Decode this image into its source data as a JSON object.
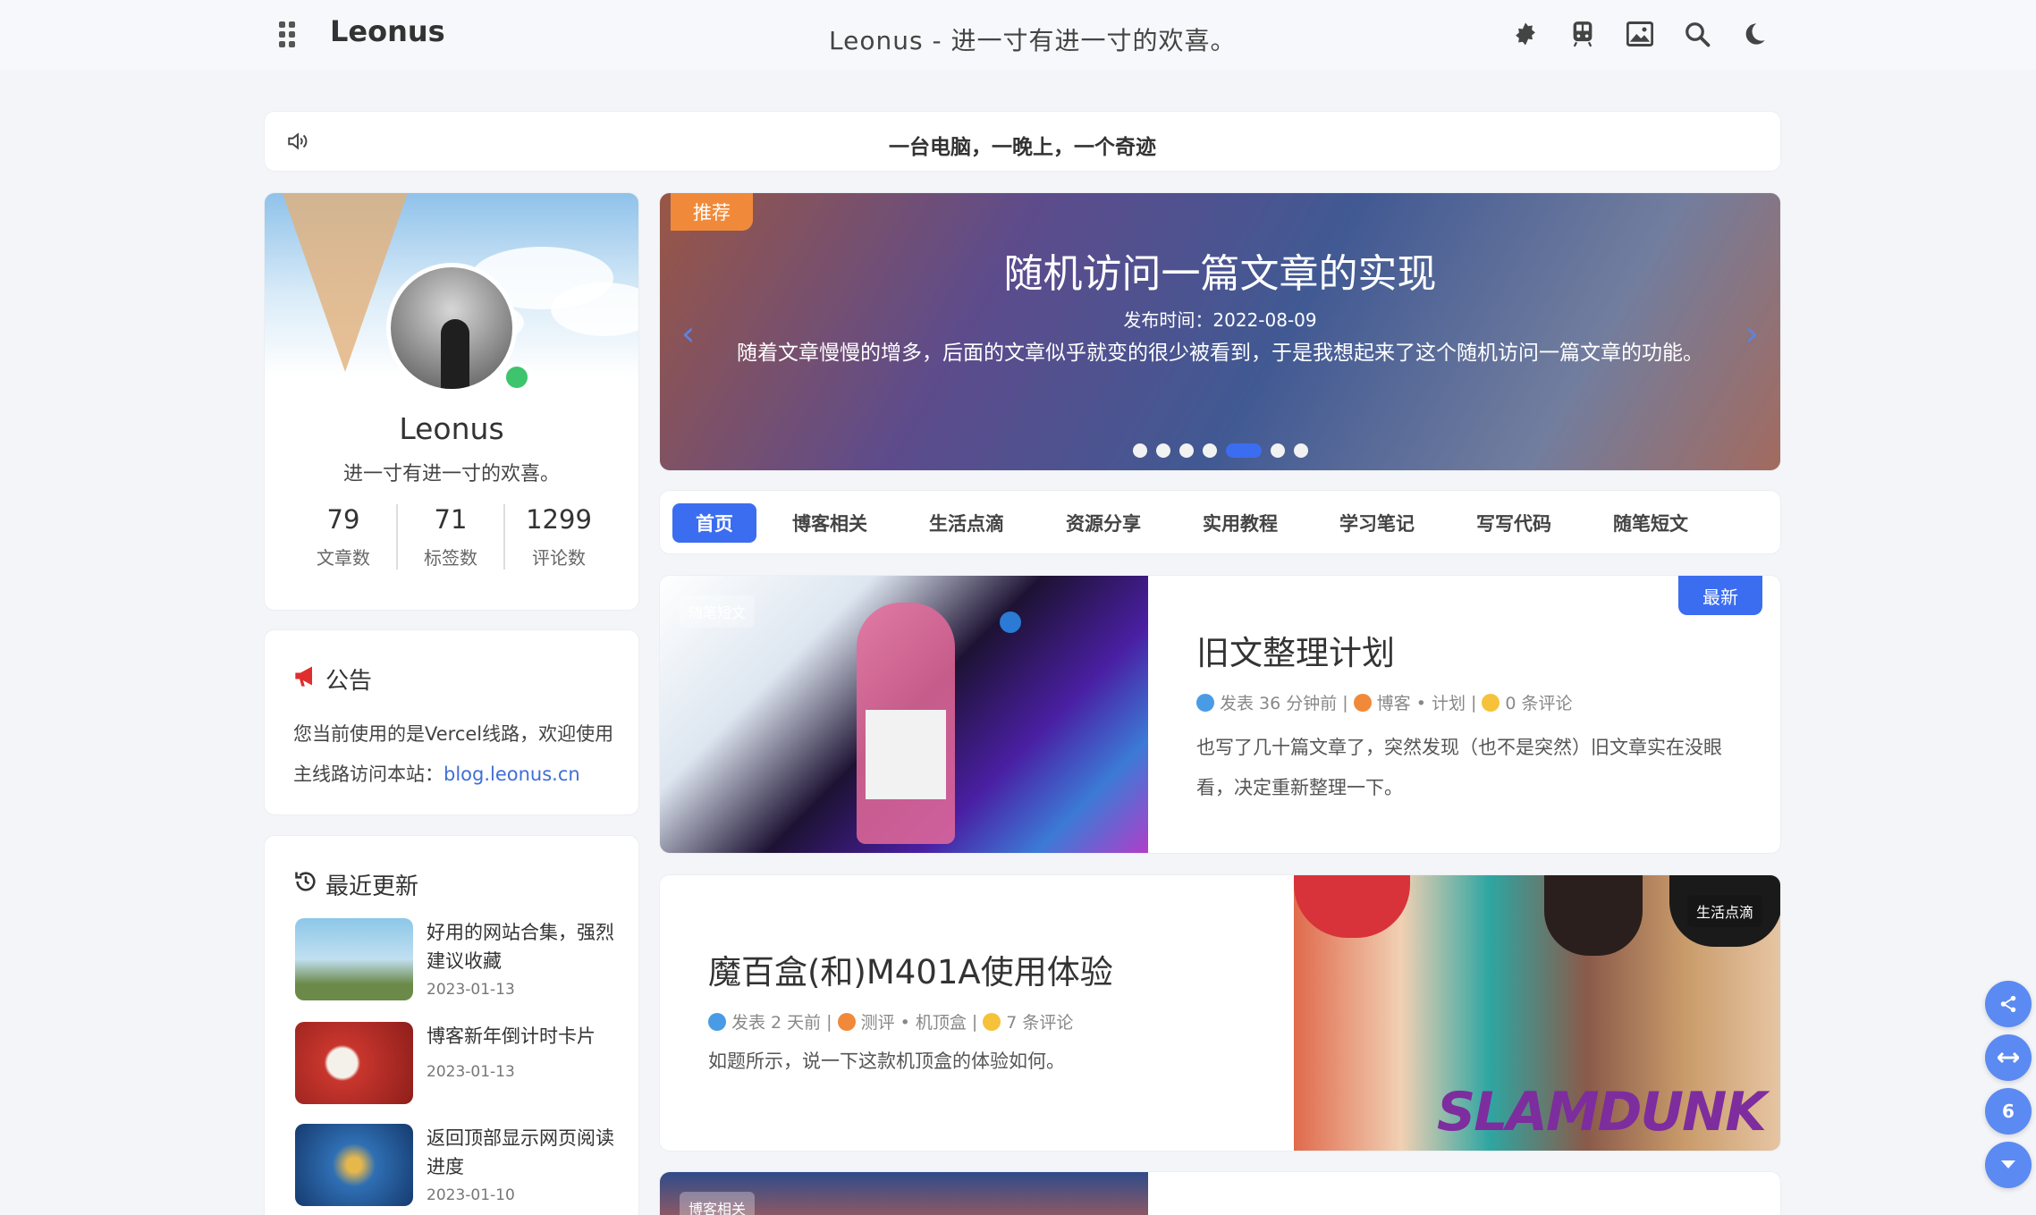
{
  "header": {
    "logo": "Leonus",
    "site_title": "Leonus - 进一寸有进一寸的欢喜。",
    "icons": [
      "puzzle-icon",
      "train-icon",
      "image-icon",
      "search-icon",
      "moon-icon"
    ]
  },
  "notice": {
    "text": "一台电脑，一晚上，一个奇迹"
  },
  "profile": {
    "name": "Leonus",
    "motto": "进一寸有进一寸的欢喜。",
    "stats": [
      {
        "value": "79",
        "label": "文章数"
      },
      {
        "value": "71",
        "label": "标签数"
      },
      {
        "value": "1299",
        "label": "评论数"
      }
    ]
  },
  "announcement": {
    "title": "公告",
    "body": "您当前使用的是Vercel线路，欢迎使用主线路访问本站：",
    "link": "blog.leonus.cn"
  },
  "recent": {
    "title": "最近更新",
    "items": [
      {
        "title": "好用的网站合集，强烈建议收藏",
        "date": "2023-01-13"
      },
      {
        "title": "博客新年倒计时卡片",
        "date": "2023-01-13"
      },
      {
        "title": "返回顶部显示网页阅读进度",
        "date": "2023-01-10"
      }
    ]
  },
  "banner": {
    "tag": "推荐",
    "title": "随机访问一篇文章的实现",
    "date": "发布时间：2022-08-09",
    "desc": "随着文章慢慢的增多，后面的文章似乎就变的很少被看到，于是我想起来了这个随机访问一篇文章的功能。",
    "slide_count": 7,
    "active_slide": 5
  },
  "tabs": [
    "首页",
    "博客相关",
    "生活点滴",
    "资源分享",
    "实用教程",
    "学习笔记",
    "写写代码",
    "随笔短文"
  ],
  "posts": [
    {
      "category": "随笔短文",
      "badge": "最新",
      "title": "旧文整理计划",
      "meta_time": "发表 36 分钟前",
      "meta_tags": "博客 • 计划",
      "meta_comments": "0 条评论",
      "desc": "也写了几十篇文章了，突然发现（也不是突然）旧文章实在没眼看，决定重新整理一下。"
    },
    {
      "category": "生活点滴",
      "title": "魔百盒(和)M401A使用体验",
      "meta_time": "发表 2 天前",
      "meta_tags": "测评 • 机顶盒",
      "meta_comments": "7 条评论",
      "desc": "如题所示，说一下这款机顶盒的体验如何。",
      "image_text": "SLAMDUNK"
    },
    {
      "category": "博客相关"
    }
  ],
  "floating": {
    "progress_label": "6"
  },
  "colors": {
    "accent": "#3b6df0",
    "tag_orange": "#f08a3a",
    "online": "#3ec46d"
  }
}
